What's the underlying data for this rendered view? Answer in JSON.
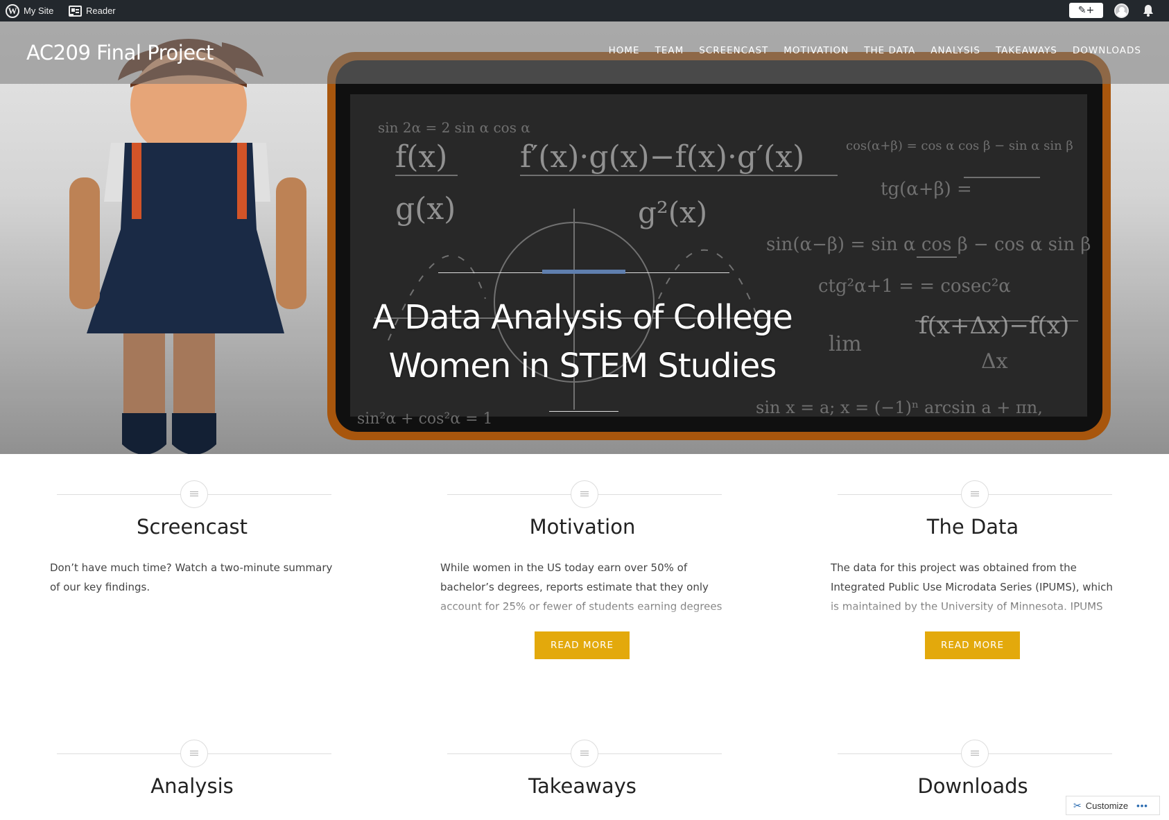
{
  "admin_bar": {
    "my_site": "My Site",
    "reader": "Reader",
    "write_icon": "pencil-plus-icon",
    "notifications_icon": "bell-icon"
  },
  "site": {
    "title": "AC209 Final Project"
  },
  "nav": [
    "HOME",
    "TEAM",
    "SCREENCAST",
    "MOTIVATION",
    "THE DATA",
    "ANALYSIS",
    "TAKEAWAYS",
    "DOWNLOADS"
  ],
  "hero": {
    "headline": "A Data Analysis of College Women in STEM Studies",
    "accent_color": "#5f7fae"
  },
  "cards": [
    {
      "title": "Screencast",
      "excerpt": "Don’t have much time? Watch a two-minute summary of our key findings.",
      "button": ""
    },
    {
      "title": "Motivation",
      "excerpt": "While women in the US today earn over 50% of bachelor’s degrees, reports estimate that they only account for 25% or fewer of students earning degrees",
      "button": "READ MORE"
    },
    {
      "title": "The Data",
      "excerpt": "The data for this project was obtained from the Integrated Public Use Microdata Series (IPUMS), which is maintained by the University of Minnesota. IPUMS",
      "button": "READ MORE"
    },
    {
      "title": "Analysis",
      "excerpt": "",
      "button": ""
    },
    {
      "title": "Takeaways",
      "excerpt": "",
      "button": ""
    },
    {
      "title": "Downloads",
      "excerpt": "",
      "button": ""
    }
  ],
  "customize": {
    "label": "Customize",
    "more": "•••"
  },
  "colors": {
    "button": "#e3a90c",
    "admin_bar": "#23282d"
  }
}
